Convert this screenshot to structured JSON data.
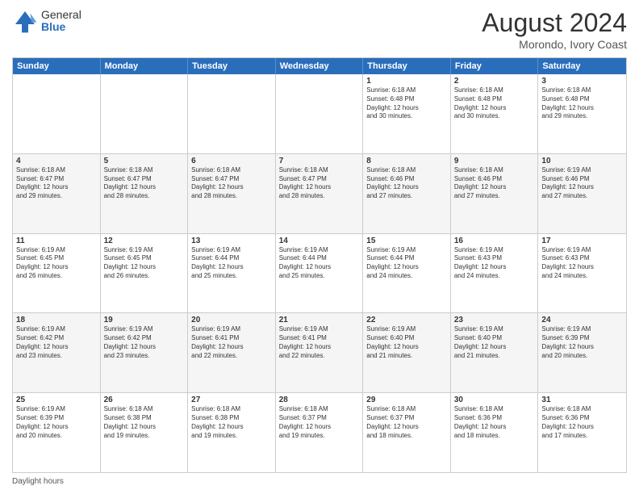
{
  "header": {
    "logo_general": "General",
    "logo_blue": "Blue",
    "month_year": "August 2024",
    "location": "Morondo, Ivory Coast"
  },
  "calendar": {
    "days": [
      "Sunday",
      "Monday",
      "Tuesday",
      "Wednesday",
      "Thursday",
      "Friday",
      "Saturday"
    ],
    "weeks": [
      [
        {
          "day": "",
          "text": ""
        },
        {
          "day": "",
          "text": ""
        },
        {
          "day": "",
          "text": ""
        },
        {
          "day": "",
          "text": ""
        },
        {
          "day": "1",
          "text": "Sunrise: 6:18 AM\nSunset: 6:48 PM\nDaylight: 12 hours\nand 30 minutes."
        },
        {
          "day": "2",
          "text": "Sunrise: 6:18 AM\nSunset: 6:48 PM\nDaylight: 12 hours\nand 30 minutes."
        },
        {
          "day": "3",
          "text": "Sunrise: 6:18 AM\nSunset: 6:48 PM\nDaylight: 12 hours\nand 29 minutes."
        }
      ],
      [
        {
          "day": "4",
          "text": "Sunrise: 6:18 AM\nSunset: 6:47 PM\nDaylight: 12 hours\nand 29 minutes."
        },
        {
          "day": "5",
          "text": "Sunrise: 6:18 AM\nSunset: 6:47 PM\nDaylight: 12 hours\nand 28 minutes."
        },
        {
          "day": "6",
          "text": "Sunrise: 6:18 AM\nSunset: 6:47 PM\nDaylight: 12 hours\nand 28 minutes."
        },
        {
          "day": "7",
          "text": "Sunrise: 6:18 AM\nSunset: 6:47 PM\nDaylight: 12 hours\nand 28 minutes."
        },
        {
          "day": "8",
          "text": "Sunrise: 6:18 AM\nSunset: 6:46 PM\nDaylight: 12 hours\nand 27 minutes."
        },
        {
          "day": "9",
          "text": "Sunrise: 6:18 AM\nSunset: 6:46 PM\nDaylight: 12 hours\nand 27 minutes."
        },
        {
          "day": "10",
          "text": "Sunrise: 6:19 AM\nSunset: 6:46 PM\nDaylight: 12 hours\nand 27 minutes."
        }
      ],
      [
        {
          "day": "11",
          "text": "Sunrise: 6:19 AM\nSunset: 6:45 PM\nDaylight: 12 hours\nand 26 minutes."
        },
        {
          "day": "12",
          "text": "Sunrise: 6:19 AM\nSunset: 6:45 PM\nDaylight: 12 hours\nand 26 minutes."
        },
        {
          "day": "13",
          "text": "Sunrise: 6:19 AM\nSunset: 6:44 PM\nDaylight: 12 hours\nand 25 minutes."
        },
        {
          "day": "14",
          "text": "Sunrise: 6:19 AM\nSunset: 6:44 PM\nDaylight: 12 hours\nand 25 minutes."
        },
        {
          "day": "15",
          "text": "Sunrise: 6:19 AM\nSunset: 6:44 PM\nDaylight: 12 hours\nand 24 minutes."
        },
        {
          "day": "16",
          "text": "Sunrise: 6:19 AM\nSunset: 6:43 PM\nDaylight: 12 hours\nand 24 minutes."
        },
        {
          "day": "17",
          "text": "Sunrise: 6:19 AM\nSunset: 6:43 PM\nDaylight: 12 hours\nand 24 minutes."
        }
      ],
      [
        {
          "day": "18",
          "text": "Sunrise: 6:19 AM\nSunset: 6:42 PM\nDaylight: 12 hours\nand 23 minutes."
        },
        {
          "day": "19",
          "text": "Sunrise: 6:19 AM\nSunset: 6:42 PM\nDaylight: 12 hours\nand 23 minutes."
        },
        {
          "day": "20",
          "text": "Sunrise: 6:19 AM\nSunset: 6:41 PM\nDaylight: 12 hours\nand 22 minutes."
        },
        {
          "day": "21",
          "text": "Sunrise: 6:19 AM\nSunset: 6:41 PM\nDaylight: 12 hours\nand 22 minutes."
        },
        {
          "day": "22",
          "text": "Sunrise: 6:19 AM\nSunset: 6:40 PM\nDaylight: 12 hours\nand 21 minutes."
        },
        {
          "day": "23",
          "text": "Sunrise: 6:19 AM\nSunset: 6:40 PM\nDaylight: 12 hours\nand 21 minutes."
        },
        {
          "day": "24",
          "text": "Sunrise: 6:19 AM\nSunset: 6:39 PM\nDaylight: 12 hours\nand 20 minutes."
        }
      ],
      [
        {
          "day": "25",
          "text": "Sunrise: 6:19 AM\nSunset: 6:39 PM\nDaylight: 12 hours\nand 20 minutes."
        },
        {
          "day": "26",
          "text": "Sunrise: 6:18 AM\nSunset: 6:38 PM\nDaylight: 12 hours\nand 19 minutes."
        },
        {
          "day": "27",
          "text": "Sunrise: 6:18 AM\nSunset: 6:38 PM\nDaylight: 12 hours\nand 19 minutes."
        },
        {
          "day": "28",
          "text": "Sunrise: 6:18 AM\nSunset: 6:37 PM\nDaylight: 12 hours\nand 19 minutes."
        },
        {
          "day": "29",
          "text": "Sunrise: 6:18 AM\nSunset: 6:37 PM\nDaylight: 12 hours\nand 18 minutes."
        },
        {
          "day": "30",
          "text": "Sunrise: 6:18 AM\nSunset: 6:36 PM\nDaylight: 12 hours\nand 18 minutes."
        },
        {
          "day": "31",
          "text": "Sunrise: 6:18 AM\nSunset: 6:36 PM\nDaylight: 12 hours\nand 17 minutes."
        }
      ]
    ]
  },
  "footer": {
    "text": "Daylight hours"
  }
}
